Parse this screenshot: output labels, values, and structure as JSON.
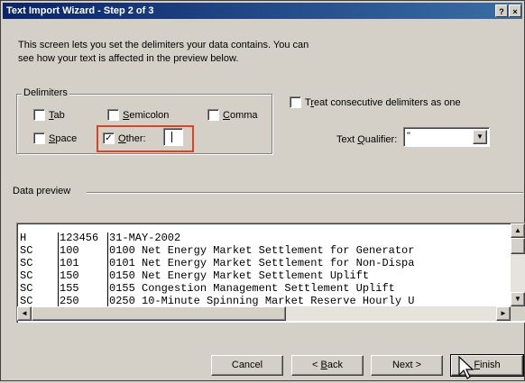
{
  "window": {
    "title": "Text Import Wizard - Step 2 of 3",
    "help_glyph": "?",
    "close_glyph": "×"
  },
  "intro": {
    "line1": "This screen lets you set the delimiters your data contains.  You can",
    "line2": "see how your text is affected in the preview below."
  },
  "delimiters": {
    "group_label": "Delimiters",
    "tab": {
      "label_mnemonic": "T",
      "label_rest": "ab",
      "checked": false
    },
    "semicolon": {
      "label_mnemonic": "S",
      "label_rest": "emicolon",
      "checked": false
    },
    "comma": {
      "label_mnemonic": "C",
      "label_rest": "omma",
      "checked": false
    },
    "space": {
      "label_mnemonic": "S",
      "label_rest": "pace",
      "checked": false
    },
    "other": {
      "label_mnemonic": "O",
      "label_rest": "ther:",
      "checked": true,
      "check_glyph": "✓",
      "value": ""
    }
  },
  "consecutive": {
    "label_pre": "T",
    "label_mnemonic": "r",
    "label_rest": "eat consecutive delimiters as one",
    "checked": false
  },
  "text_qualifier": {
    "label_pre": "Text ",
    "label_mnemonic": "Q",
    "label_rest": "ualifier:",
    "value": "\"",
    "dropdown_glyph": "▼"
  },
  "preview": {
    "group_label": "Data preview",
    "rows": [
      {
        "c1": "H",
        "c2": "123456",
        "c3": "31-MAY-2002"
      },
      {
        "c1": "SC",
        "c2": "100",
        "c3": "0100 Net Energy Market Settlement for Generator"
      },
      {
        "c1": "SC",
        "c2": "101",
        "c3": "0101 Net Energy Market Settlement for Non-Dispa"
      },
      {
        "c1": "SC",
        "c2": "150",
        "c3": "0150 Net Energy Market Settlement Uplift"
      },
      {
        "c1": "SC",
        "c2": "155",
        "c3": "0155 Congestion Management Settlement Uplift"
      },
      {
        "c1": "SC",
        "c2": "250",
        "c3": "0250 10-Minute Spinning Market Reserve Hourly U"
      }
    ],
    "scroll_up_glyph": "▲",
    "scroll_down_glyph": "▼",
    "scroll_left_glyph": "◄",
    "scroll_right_glyph": "►"
  },
  "buttons": {
    "cancel": "Cancel",
    "back_pre": "< ",
    "back_mnemonic": "B",
    "back_rest": "ack",
    "next": "Next >",
    "finish_mnemonic": "F",
    "finish_rest": "inish"
  },
  "colors": {
    "title_bar": "#0a246a",
    "highlight_box": "#e0411f",
    "dialog_face": "#d4d0c8"
  }
}
